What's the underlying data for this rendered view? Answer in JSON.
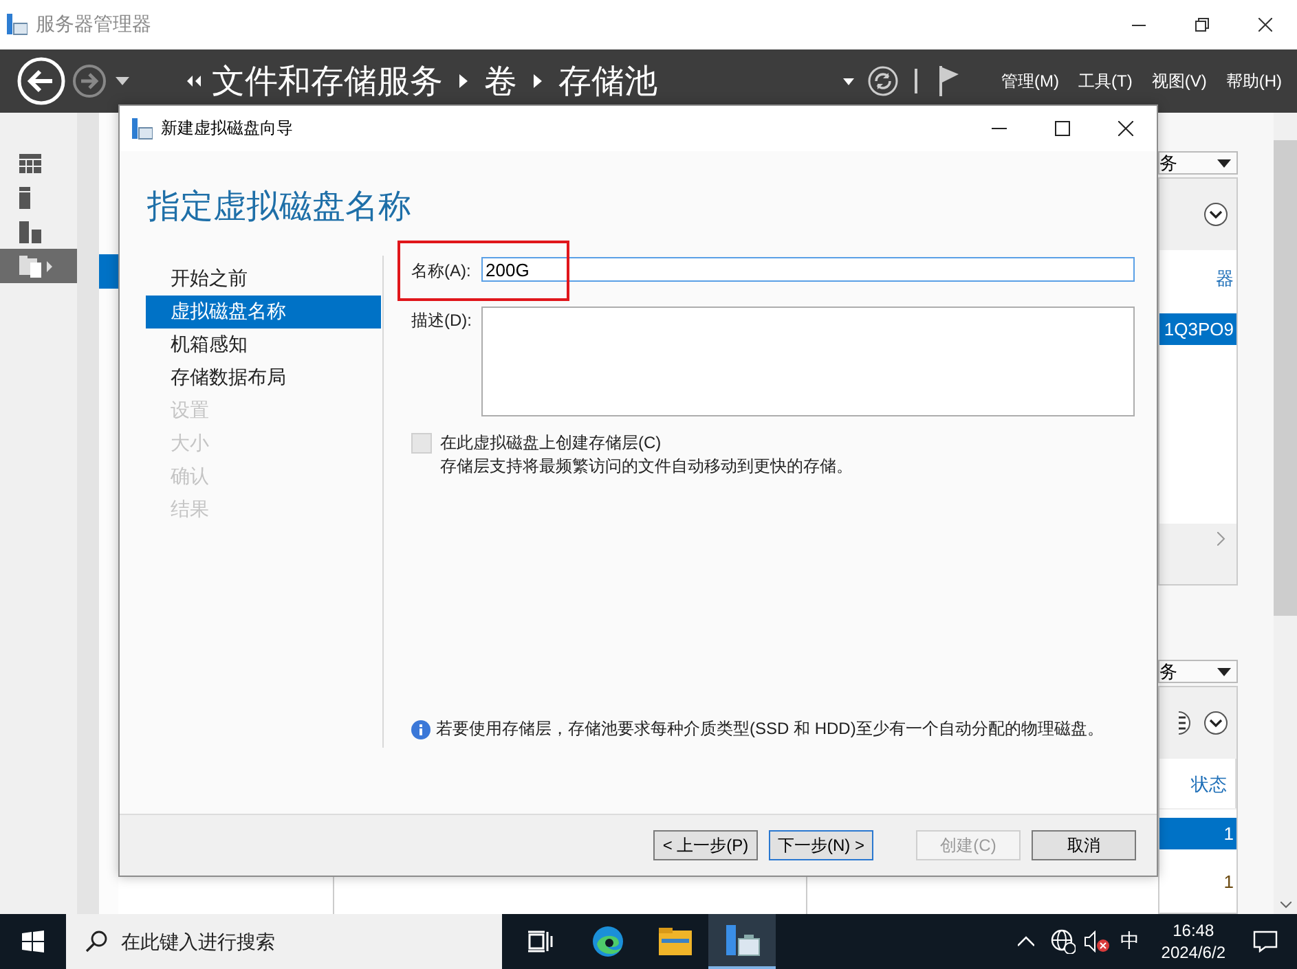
{
  "window": {
    "title": "服务器管理器"
  },
  "header": {
    "breadcrumb": [
      "文件和存储服务",
      "卷",
      "存储池"
    ],
    "menus": [
      "管理(M)",
      "工具(T)",
      "视图(V)",
      "帮助(H)"
    ]
  },
  "nav": {
    "items": [
      {
        "kind": "dashboard",
        "selected": false
      },
      {
        "kind": "local",
        "selected": false
      },
      {
        "kind": "all",
        "selected": false
      },
      {
        "kind": "files",
        "selected": true
      }
    ]
  },
  "subnav": {
    "items": [
      {
        "selected": true
      }
    ]
  },
  "panels": [
    {
      "tasks": "务",
      "rows": [
        {
          "text": "器",
          "selected": false
        },
        {
          "text": "1Q3PO9",
          "selected": true
        }
      ]
    },
    {
      "tasks": "务",
      "columns": [
        "状态"
      ],
      "rows": [
        {
          "text": "1",
          "selected": true
        },
        {
          "text": "1",
          "selected": false
        }
      ]
    }
  ],
  "dialog": {
    "title": "新建虚拟磁盘向导",
    "heading": "指定虚拟磁盘名称",
    "steps": [
      {
        "label": "开始之前",
        "selected": false,
        "disabled": false
      },
      {
        "label": "虚拟磁盘名称",
        "selected": true,
        "disabled": false
      },
      {
        "label": "机箱感知",
        "selected": false,
        "disabled": false
      },
      {
        "label": "存储数据布局",
        "selected": false,
        "disabled": false
      },
      {
        "label": "设置",
        "selected": false,
        "disabled": true
      },
      {
        "label": "大小",
        "selected": false,
        "disabled": true
      },
      {
        "label": "确认",
        "selected": false,
        "disabled": true
      },
      {
        "label": "结果",
        "selected": false,
        "disabled": true
      }
    ],
    "name_label": "名称(A):",
    "name_value": "200G",
    "name_highlighted": true,
    "description_label": "描述(D):",
    "tier_checkbox": {
      "label": "在此虚拟磁盘上创建存储层(C)",
      "checked": false,
      "disabled": true
    },
    "tier_note": "存储层支持将最频繁访问的文件自动移动到更快的存储。",
    "info": "若要使用存储层，存储池要求每种介质类型(SSD 和 HDD)至少有一个自动分配的物理磁盘。",
    "buttons": [
      {
        "label": "< 上一步(P)",
        "disabled": false,
        "default": false
      },
      {
        "label": "下一步(N) >",
        "disabled": false,
        "default": true
      },
      {
        "label": "创建(C)",
        "disabled": true,
        "default": false
      },
      {
        "label": "取消",
        "disabled": false,
        "default": false
      }
    ]
  },
  "taskbar": {
    "search_placeholder": "在此键入进行搜索",
    "apps": [
      {
        "kind": "taskview",
        "active": false
      },
      {
        "kind": "edge",
        "active": false
      },
      {
        "kind": "folder",
        "active": false
      },
      {
        "kind": "servermanager",
        "active": true
      }
    ],
    "ime": "中",
    "time": "16:48",
    "date": "2024/6/2"
  }
}
